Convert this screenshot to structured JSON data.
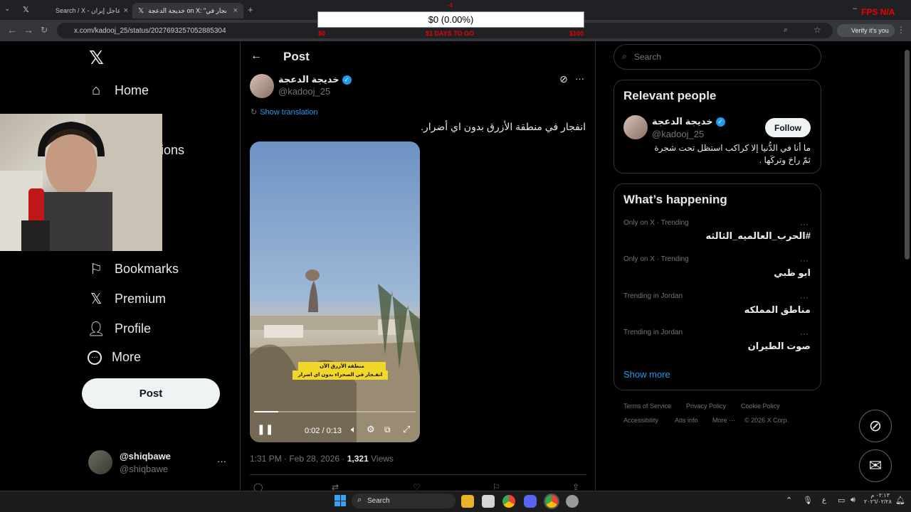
{
  "browser": {
    "tabs": [
      {
        "label": "Search / X - عاجل إيران",
        "icon": "x-logo-icon"
      },
      {
        "label": "خديجة الدعجة on X: \"انفجار في",
        "icon": "x-logo-icon"
      }
    ],
    "url": "x.com/kadooj_25/status/2027693257052885304",
    "profile_label": "Verify it's you"
  },
  "overlay": {
    "amount": "$0 (0.00%)",
    "top_marker": "-4",
    "left_label": "$0",
    "center_label": "$1 DAYS TO GO",
    "right_label": "$100",
    "corner_label": "FPS N/A"
  },
  "nav": {
    "items": [
      {
        "label": "Home",
        "icon": "home-icon"
      },
      {
        "label": "Notifications",
        "icon": "bell-icon"
      },
      {
        "label": "Bookmarks",
        "icon": "bookmark-icon"
      },
      {
        "label": "Premium",
        "icon": "x-logo-icon"
      },
      {
        "label": "Profile",
        "icon": "person-icon"
      },
      {
        "label": "More",
        "icon": "more-circle-icon"
      }
    ],
    "post_label": "Post",
    "account": {
      "name": "@shiqbawe",
      "handle": "@shiqbawe"
    }
  },
  "post": {
    "header_title": "Post",
    "author_name": "خديجة الدعجة",
    "author_handle": "@kadooj_25",
    "show_translation": "Show translation",
    "text": "انفجار في منطقة الأزرق بدون اي أضرار.",
    "video_caption_line1": "منطقة الأزرق الآن",
    "video_caption_line2": "انفـجار في الصحراء بدون اي اضرار",
    "video_time": "0:02 / 0:13",
    "video_progress": 0.15,
    "timestamp": "1:31 PM · Feb 28, 2026 ·",
    "views_count": "1,321",
    "views_label": "Views"
  },
  "right": {
    "search_placeholder": "Search",
    "relevant_title": "Relevant people",
    "person_name": "خديجة الدعجة",
    "person_handle": "@kadooj_25",
    "follow_label": "Follow",
    "person_bio_line1": "ما أنا في الدُّنيا إلا كراكب استظل تحت شجرة",
    "person_bio_line2": "ثمّ راحَ وتركَها .",
    "happening_title": "What’s happening",
    "trends": [
      {
        "context": "Only on X · Trending",
        "title": "#الحرب_العالميه_الثالثه"
      },
      {
        "context": "Only on X · Trending",
        "title": "ابو ظبي"
      },
      {
        "context": "Trending in Jordan",
        "title": "مناطق المملكه"
      },
      {
        "context": "Trending in Jordan",
        "title": "صوت الطيران"
      }
    ],
    "show_more": "Show more",
    "footer": [
      "Terms of Service",
      "Privacy Policy",
      "Cookie Policy",
      "Accessibility",
      "Ads info",
      "More ···",
      "© 2026 X Corp."
    ]
  },
  "taskbar": {
    "search_label": "Search",
    "time": "٠٢:١٣ م",
    "date": "٢٠٢٦/٠٢/٢٨",
    "lang": "ع"
  },
  "colors": {
    "accent": "#1d9bf0",
    "text": "#e7e9ea",
    "muted": "#71767b"
  }
}
